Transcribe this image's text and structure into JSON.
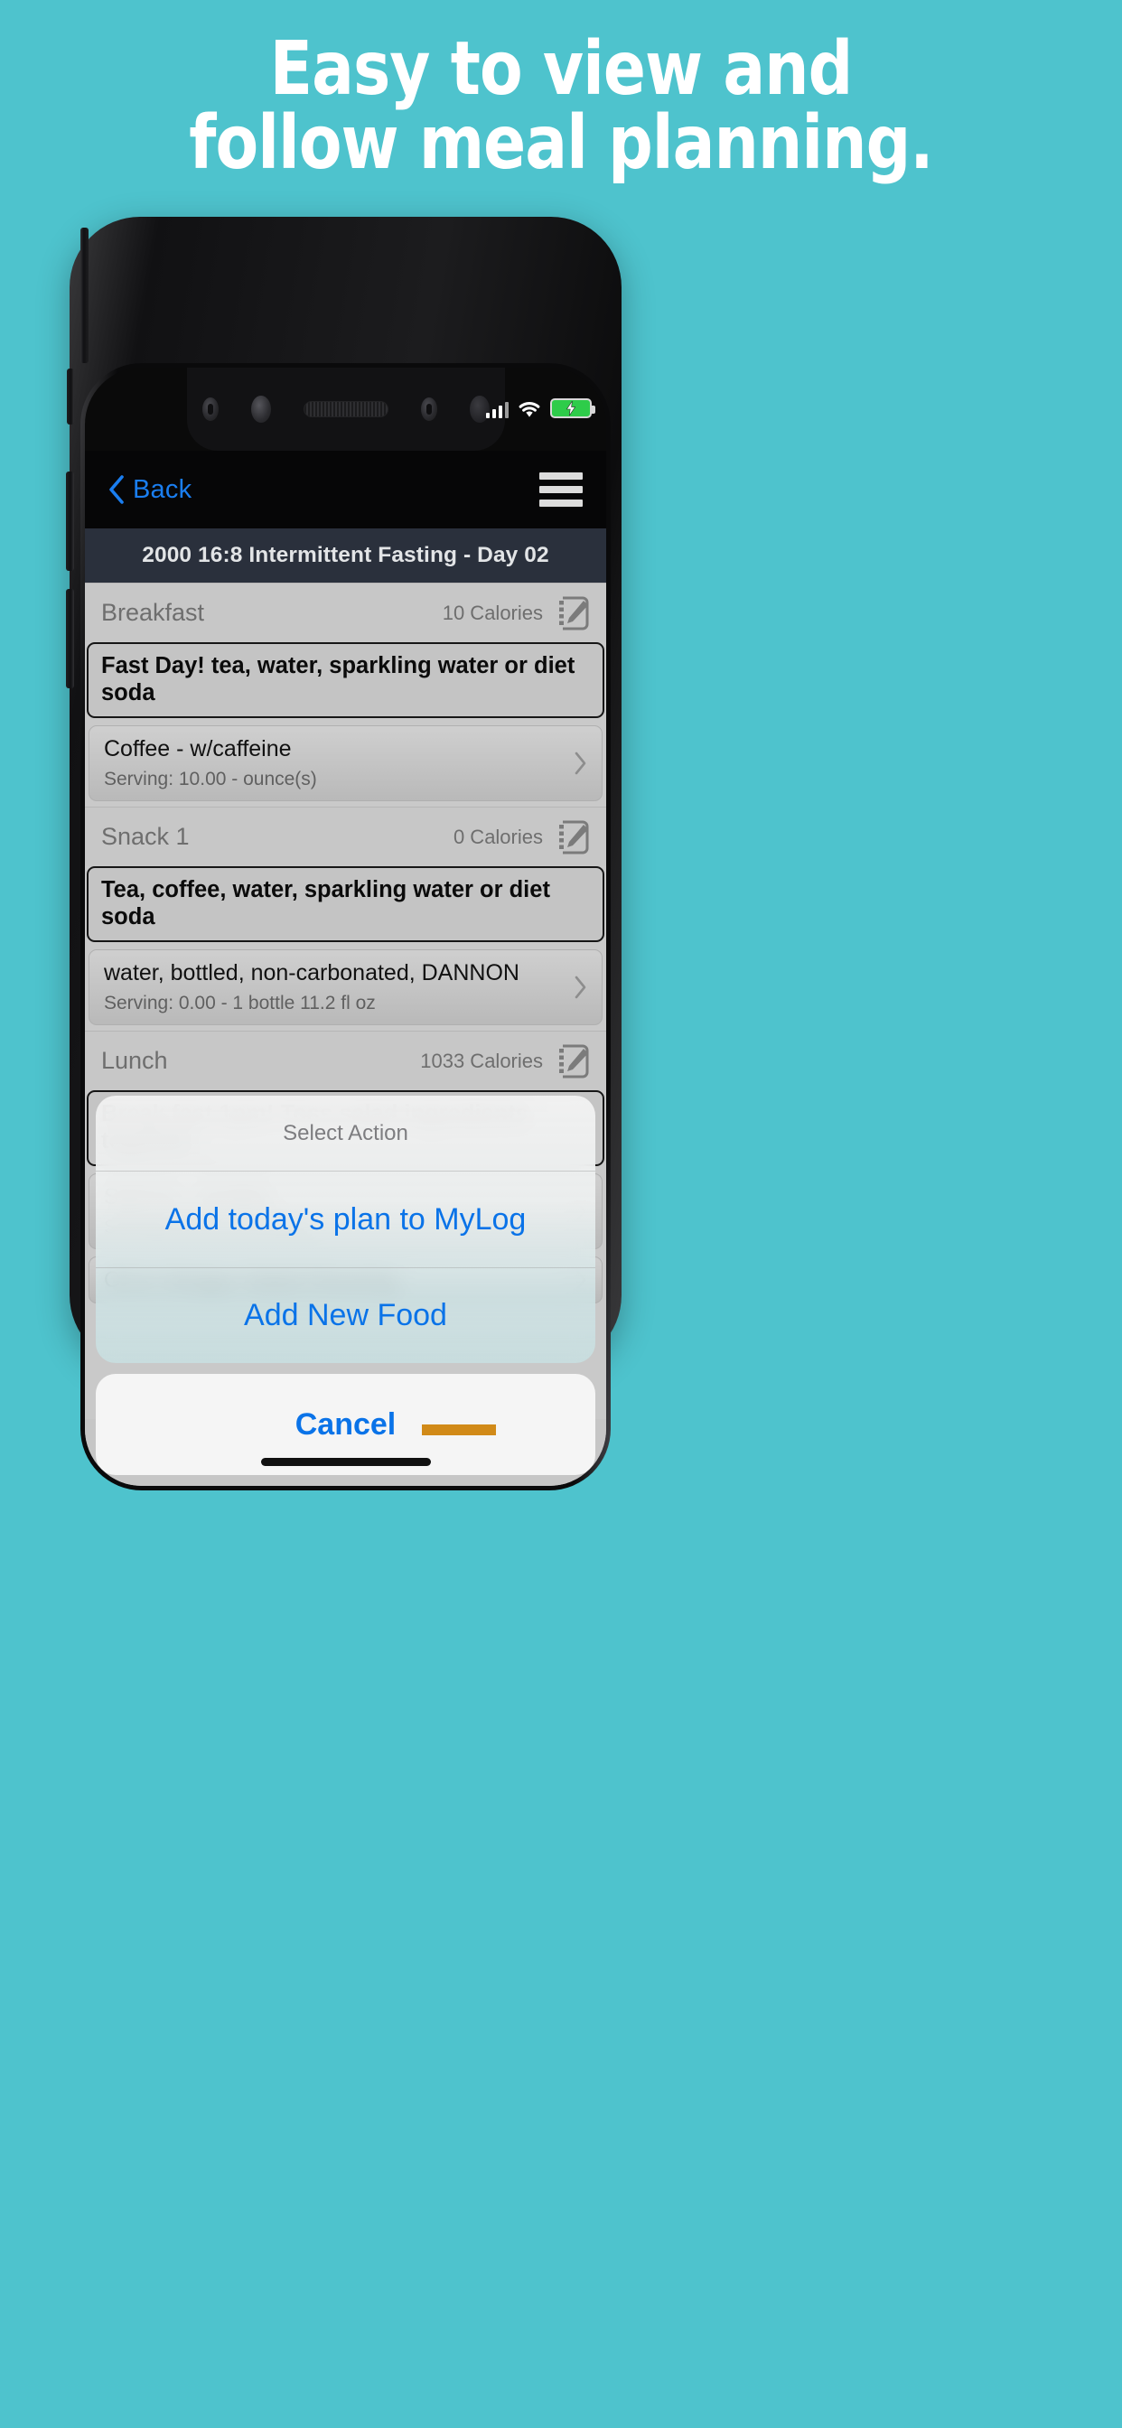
{
  "promo": {
    "background_color": "#4ec3cd",
    "headline_lines": [
      "Easy to view and",
      "follow meal planning."
    ]
  },
  "status_bar": {
    "signal_icon": "cellular-signal-icon",
    "wifi_icon": "wifi-icon",
    "battery_icon": "battery-charging-icon",
    "battery_color": "#2ecc4a"
  },
  "navbar": {
    "back_label": "Back",
    "back_icon": "chevron-left-icon",
    "back_color": "#1a7ef0",
    "menu_icon": "hamburger-menu-icon"
  },
  "title_bar": {
    "title": "2000 16:8  Intermittent Fasting - Day 02"
  },
  "meals": [
    {
      "name": "Breakfast",
      "calories": "10 Calories",
      "note": "Fast Day! tea, water, sparkling water or diet soda",
      "foods": [
        {
          "name": "Coffee - w/caffeine",
          "serving": "Serving: 10.00 - ounce(s)"
        }
      ]
    },
    {
      "name": "Snack 1",
      "calories": "0 Calories",
      "note": "Tea, coffee, water, sparkling water or diet soda",
      "foods": [
        {
          "name": "water, bottled, non-carbonated, DANNON",
          "serving": "Serving: 0.00 - 1 bottle 11.2 fl oz"
        }
      ]
    },
    {
      "name": "Lunch",
      "calories": "1033 Calories",
      "note": "Break fast 1pm! Toss salad ingredients together.",
      "foods": [
        {
          "name": "Salmon - broiled",
          "serving": "Serving: 5.00 - ounce(s)"
        },
        {
          "name": "Oil & Vinegar Salad Dressing",
          "serving": ""
        }
      ]
    }
  ],
  "action_sheet": {
    "title": "Select Action",
    "items": [
      "Add today's plan to MyLog",
      "Add New Food"
    ],
    "cancel_label": "Cancel",
    "tint_color": "#0a73e8"
  },
  "icons": {
    "note_edit": "note-edit-icon",
    "row_chevron": "chevron-right-icon",
    "home_indicator": "home-indicator"
  }
}
